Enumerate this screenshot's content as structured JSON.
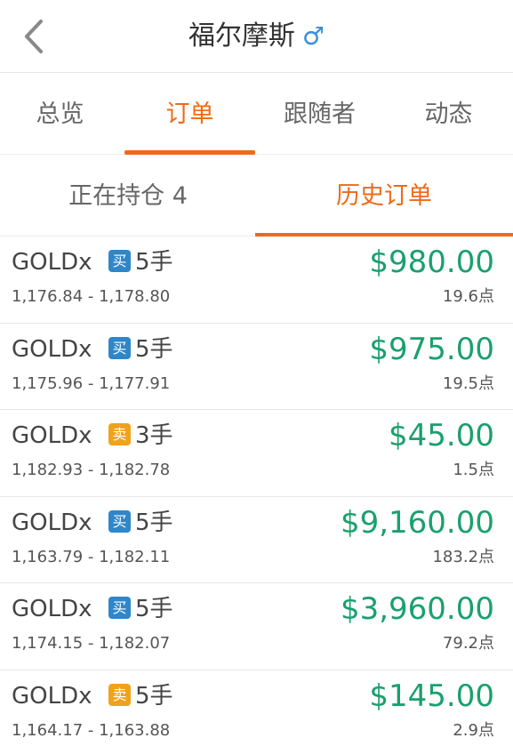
{
  "header": {
    "title": "福尔摩斯",
    "gender_symbol": "♂",
    "back_icon": "chevron-left-icon"
  },
  "tabs": [
    {
      "label": "总览",
      "active": false
    },
    {
      "label": "订单",
      "active": true
    },
    {
      "label": "跟随者",
      "active": false
    },
    {
      "label": "动态",
      "active": false
    }
  ],
  "subtabs": [
    {
      "label": "正在持仓 4",
      "active": false
    },
    {
      "label": "历史订单",
      "active": true
    }
  ],
  "colors": {
    "accent": "#ef6a17",
    "profit": "#1aa06e",
    "buy_badge": "#2f86c9",
    "sell_badge": "#f0a21a",
    "gender": "#3a8fd8"
  },
  "orders": [
    {
      "symbol": "GOLDx",
      "side": "买",
      "side_type": "buy",
      "lots": "5手",
      "prices": "1,176.84 - 1,178.80",
      "profit": "$980.00",
      "points": "19.6点"
    },
    {
      "symbol": "GOLDx",
      "side": "买",
      "side_type": "buy",
      "lots": "5手",
      "prices": "1,175.96 - 1,177.91",
      "profit": "$975.00",
      "points": "19.5点"
    },
    {
      "symbol": "GOLDx",
      "side": "卖",
      "side_type": "sell",
      "lots": "3手",
      "prices": "1,182.93 - 1,182.78",
      "profit": "$45.00",
      "points": "1.5点"
    },
    {
      "symbol": "GOLDx",
      "side": "买",
      "side_type": "buy",
      "lots": "5手",
      "prices": "1,163.79 - 1,182.11",
      "profit": "$9,160.00",
      "points": "183.2点"
    },
    {
      "symbol": "GOLDx",
      "side": "买",
      "side_type": "buy",
      "lots": "5手",
      "prices": "1,174.15 - 1,182.07",
      "profit": "$3,960.00",
      "points": "79.2点"
    },
    {
      "symbol": "GOLDx",
      "side": "卖",
      "side_type": "sell",
      "lots": "5手",
      "prices": "1,164.17 - 1,163.88",
      "profit": "$145.00",
      "points": "2.9点"
    }
  ]
}
